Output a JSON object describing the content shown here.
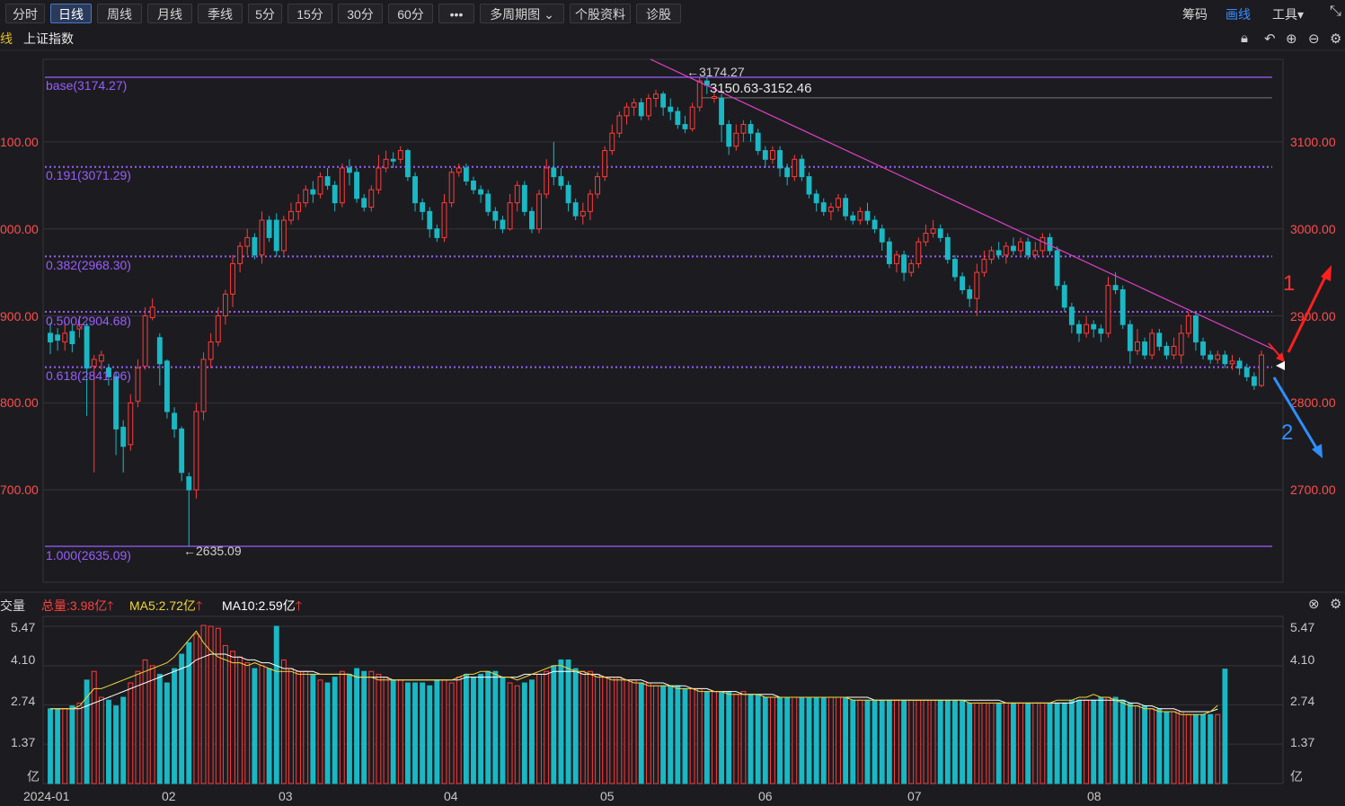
{
  "toolbar": {
    "tabs": [
      "分时",
      "日线",
      "周线",
      "月线",
      "季线",
      "5分",
      "15分",
      "30分",
      "60分",
      "•••",
      "多周期图 ⌄",
      "个股资料",
      "诊股"
    ],
    "active_tab": "日线",
    "right": [
      "筹码",
      "画线",
      "工具▾"
    ]
  },
  "subheader": {
    "prefix": "线",
    "index_name": "上证指数"
  },
  "price_axis": {
    "left": [
      "100.00",
      "000.00",
      "900.00",
      "800.00",
      "700.00"
    ],
    "right": [
      "3100.00",
      "3000.00",
      "2900.00",
      "2800.00",
      "2700.00"
    ]
  },
  "fib_labels": [
    "base(3174.27)",
    "0.191(3071.29)",
    "0.382(2968.30)",
    "0.500(2904.68)",
    "0.618(2841.06)",
    "1.000(2635.09)"
  ],
  "annotations": {
    "high": "←3174.27",
    "high_range": "3150.63-3152.46",
    "low": "←2635.09",
    "arrow1": "1",
    "arrow2": "2"
  },
  "volume_header": {
    "title": "交量",
    "total": "总量:3.98亿",
    "ma5": "MA5:2.72亿",
    "ma10": "MA10:2.59亿"
  },
  "volume_axis": {
    "left": [
      "5.47",
      "4.10",
      "2.74",
      "1.37",
      "亿"
    ],
    "right": [
      "5.47",
      "4.10",
      "2.74",
      "1.37",
      "亿"
    ]
  },
  "x_labels": [
    "2024-01",
    "02",
    "03",
    "04",
    "05",
    "06",
    "07",
    "08"
  ],
  "colors": {
    "up": "#ff3b3b",
    "down": "#1ab8c4",
    "fib": "#9b5cff",
    "trend": "#e040c8",
    "ma5": "#f2d43a",
    "ma10": "#ffffff"
  },
  "chart_data": {
    "type": "candlestick",
    "y_range": [
      2630,
      3180
    ],
    "ohlc": [
      [
        2880,
        2870,
        2892,
        2856
      ],
      [
        2878,
        2872,
        2886,
        2860
      ],
      [
        2870,
        2880,
        2893,
        2860
      ],
      [
        2882,
        2868,
        2890,
        2858
      ],
      [
        2885,
        2890,
        2900,
        2875
      ],
      [
        2888,
        2840,
        2892,
        2785
      ],
      [
        2842,
        2850,
        2855,
        2720
      ],
      [
        2848,
        2855,
        2860,
        2838
      ],
      [
        2840,
        2830,
        2845,
        2820
      ],
      [
        2830,
        2770,
        2836,
        2740
      ],
      [
        2772,
        2750,
        2780,
        2720
      ],
      [
        2752,
        2800,
        2810,
        2745
      ],
      [
        2802,
        2840,
        2850,
        2795
      ],
      [
        2842,
        2900,
        2910,
        2838
      ],
      [
        2898,
        2910,
        2920,
        2895
      ],
      [
        2875,
        2845,
        2880,
        2820
      ],
      [
        2848,
        2790,
        2850,
        2782
      ],
      [
        2788,
        2770,
        2795,
        2760
      ],
      [
        2770,
        2720,
        2773,
        2710
      ],
      [
        2715,
        2700,
        2720,
        2635
      ],
      [
        2700,
        2790,
        2800,
        2690
      ],
      [
        2790,
        2850,
        2858,
        2780
      ],
      [
        2850,
        2870,
        2880,
        2840
      ],
      [
        2870,
        2900,
        2910,
        2865
      ],
      [
        2900,
        2925,
        2930,
        2890
      ],
      [
        2925,
        2960,
        2970,
        2910
      ],
      [
        2960,
        2980,
        2985,
        2950
      ],
      [
        2980,
        2990,
        3000,
        2970
      ],
      [
        2990,
        2970,
        2995,
        2965
      ],
      [
        2970,
        3010,
        3020,
        2960
      ],
      [
        3010,
        2990,
        3015,
        2985
      ],
      [
        3010,
        2975,
        3018,
        2968
      ],
      [
        2975,
        3010,
        3015,
        2970
      ],
      [
        3010,
        3020,
        3030,
        3005
      ],
      [
        3020,
        3030,
        3040,
        3010
      ],
      [
        3030,
        3045,
        3050,
        3025
      ],
      [
        3045,
        3040,
        3055,
        3030
      ],
      [
        3040,
        3060,
        3065,
        3035
      ],
      [
        3060,
        3050,
        3070,
        3045
      ],
      [
        3050,
        3030,
        3055,
        3020
      ],
      [
        3030,
        3070,
        3075,
        3025
      ],
      [
        3070,
        3065,
        3080,
        3050
      ],
      [
        3065,
        3035,
        3070,
        3030
      ],
      [
        3035,
        3025,
        3040,
        3020
      ],
      [
        3025,
        3045,
        3050,
        3020
      ],
      [
        3045,
        3070,
        3085,
        3040
      ],
      [
        3070,
        3080,
        3090,
        3065
      ],
      [
        3080,
        3078,
        3088,
        3070
      ],
      [
        3080,
        3090,
        3095,
        3075
      ],
      [
        3090,
        3060,
        3092,
        3055
      ],
      [
        3060,
        3030,
        3065,
        3020
      ],
      [
        3030,
        3020,
        3035,
        3010
      ],
      [
        3020,
        3000,
        3025,
        2990
      ],
      [
        3000,
        2990,
        3005,
        2985
      ],
      [
        2990,
        3030,
        3040,
        2985
      ],
      [
        3030,
        3065,
        3070,
        3025
      ],
      [
        3065,
        3070,
        3075,
        3060
      ],
      [
        3070,
        3055,
        3075,
        3050
      ],
      [
        3055,
        3045,
        3060,
        3040
      ],
      [
        3045,
        3040,
        3050,
        3030
      ],
      [
        3040,
        3020,
        3045,
        3015
      ],
      [
        3020,
        3010,
        3025,
        3000
      ],
      [
        3010,
        3000,
        3015,
        2995
      ],
      [
        3000,
        3030,
        3040,
        2998
      ],
      [
        3030,
        3050,
        3055,
        3020
      ],
      [
        3050,
        3020,
        3055,
        3015
      ],
      [
        3020,
        3000,
        3025,
        2995
      ],
      [
        3000,
        3040,
        3045,
        2995
      ],
      [
        3040,
        3070,
        3080,
        3035
      ],
      [
        3070,
        3060,
        3100,
        3050
      ],
      [
        3060,
        3050,
        3070,
        3045
      ],
      [
        3050,
        3030,
        3055,
        3020
      ],
      [
        3030,
        3015,
        3035,
        3010
      ],
      [
        3015,
        3020,
        3030,
        3005
      ],
      [
        3020,
        3040,
        3045,
        3010
      ],
      [
        3040,
        3060,
        3065,
        3035
      ],
      [
        3060,
        3090,
        3095,
        3055
      ],
      [
        3090,
        3110,
        3120,
        3085
      ],
      [
        3110,
        3130,
        3135,
        3105
      ],
      [
        3130,
        3140,
        3145,
        3120
      ],
      [
        3140,
        3145,
        3150,
        3130
      ],
      [
        3145,
        3130,
        3150,
        3125
      ],
      [
        3130,
        3150,
        3155,
        3125
      ],
      [
        3150,
        3155,
        3160,
        3140
      ],
      [
        3155,
        3140,
        3158,
        3130
      ],
      [
        3140,
        3135,
        3150,
        3125
      ],
      [
        3135,
        3120,
        3140,
        3115
      ],
      [
        3120,
        3115,
        3130,
        3110
      ],
      [
        3115,
        3140,
        3145,
        3112
      ],
      [
        3140,
        3170,
        3174,
        3135
      ],
      [
        3170,
        3165,
        3174,
        3155
      ],
      [
        3150,
        3152,
        3158,
        3145
      ],
      [
        3150,
        3120,
        3155,
        3100
      ],
      [
        3120,
        3095,
        3125,
        3085
      ],
      [
        3095,
        3110,
        3120,
        3090
      ],
      [
        3110,
        3120,
        3125,
        3100
      ],
      [
        3120,
        3110,
        3125,
        3100
      ],
      [
        3110,
        3090,
        3115,
        3085
      ],
      [
        3090,
        3080,
        3095,
        3070
      ],
      [
        3080,
        3090,
        3095,
        3075
      ],
      [
        3090,
        3070,
        3095,
        3060
      ],
      [
        3070,
        3060,
        3075,
        3050
      ],
      [
        3060,
        3080,
        3085,
        3055
      ],
      [
        3080,
        3060,
        3085,
        3055
      ],
      [
        3060,
        3040,
        3065,
        3035
      ],
      [
        3040,
        3030,
        3045,
        3020
      ],
      [
        3030,
        3020,
        3035,
        3015
      ],
      [
        3020,
        3025,
        3030,
        3010
      ],
      [
        3025,
        3035,
        3040,
        3020
      ],
      [
        3035,
        3015,
        3040,
        3010
      ],
      [
        3015,
        3010,
        3020,
        3005
      ],
      [
        3010,
        3020,
        3025,
        3005
      ],
      [
        3020,
        3010,
        3030,
        3005
      ],
      [
        3010,
        3000,
        3015,
        2995
      ],
      [
        3000,
        2985,
        3005,
        2975
      ],
      [
        2985,
        2960,
        2990,
        2955
      ],
      [
        2960,
        2970,
        2975,
        2950
      ],
      [
        2970,
        2950,
        2975,
        2940
      ],
      [
        2950,
        2960,
        2965,
        2945
      ],
      [
        2960,
        2985,
        2990,
        2955
      ],
      [
        2985,
        2995,
        3005,
        2980
      ],
      [
        2995,
        3000,
        3010,
        2990
      ],
      [
        3000,
        2990,
        3005,
        2985
      ],
      [
        2990,
        2965,
        2995,
        2960
      ],
      [
        2965,
        2945,
        2970,
        2940
      ],
      [
        2945,
        2930,
        2950,
        2925
      ],
      [
        2930,
        2920,
        2935,
        2910
      ],
      [
        2920,
        2950,
        2960,
        2900
      ],
      [
        2950,
        2965,
        2975,
        2945
      ],
      [
        2965,
        2975,
        2980,
        2960
      ],
      [
        2975,
        2970,
        2985,
        2965
      ],
      [
        2970,
        2980,
        2985,
        2960
      ],
      [
        2980,
        2975,
        2990,
        2970
      ],
      [
        2975,
        2985,
        2990,
        2970
      ],
      [
        2985,
        2970,
        2990,
        2965
      ],
      [
        2970,
        2975,
        2985,
        2965
      ],
      [
        2975,
        2990,
        2995,
        2970
      ],
      [
        2990,
        2975,
        2995,
        2970
      ],
      [
        2975,
        2935,
        2980,
        2930
      ],
      [
        2935,
        2910,
        2940,
        2905
      ],
      [
        2910,
        2890,
        2915,
        2880
      ],
      [
        2890,
        2880,
        2895,
        2870
      ],
      [
        2880,
        2890,
        2900,
        2875
      ],
      [
        2890,
        2885,
        2895,
        2875
      ],
      [
        2885,
        2880,
        2890,
        2870
      ],
      [
        2880,
        2935,
        2945,
        2875
      ],
      [
        2935,
        2930,
        2950,
        2925
      ],
      [
        2930,
        2890,
        2935,
        2885
      ],
      [
        2890,
        2860,
        2895,
        2845
      ],
      [
        2860,
        2870,
        2885,
        2855
      ],
      [
        2870,
        2855,
        2875,
        2850
      ],
      [
        2855,
        2880,
        2885,
        2850
      ],
      [
        2880,
        2865,
        2885,
        2860
      ],
      [
        2865,
        2855,
        2870,
        2850
      ],
      [
        2855,
        2865,
        2875,
        2850
      ],
      [
        2855,
        2880,
        2890,
        2845
      ],
      [
        2880,
        2900,
        2905,
        2875
      ],
      [
        2900,
        2870,
        2905,
        2860
      ],
      [
        2870,
        2855,
        2875,
        2850
      ],
      [
        2855,
        2850,
        2860,
        2845
      ],
      [
        2850,
        2855,
        2860,
        2845
      ],
      [
        2855,
        2845,
        2860,
        2840
      ],
      [
        2845,
        2848,
        2855,
        2838
      ],
      [
        2848,
        2840,
        2852,
        2832
      ],
      [
        2840,
        2830,
        2845,
        2825
      ],
      [
        2830,
        2820,
        2835,
        2815
      ],
      [
        2820,
        2855,
        2860,
        2818
      ]
    ],
    "volume_range": [
      0,
      5.47
    ],
    "volume": [
      2.6,
      2.6,
      2.6,
      2.7,
      2.8,
      3.6,
      3.9,
      3.0,
      2.9,
      2.7,
      3.0,
      3.5,
      3.9,
      4.3,
      4.1,
      3.8,
      3.5,
      4.0,
      4.5,
      4.9,
      5.2,
      5.5,
      5.47,
      5.4,
      4.8,
      4.6,
      4.4,
      4.2,
      4.0,
      4.1,
      4.0,
      5.47,
      4.3,
      4.0,
      3.9,
      3.9,
      3.8,
      3.6,
      3.5,
      3.7,
      3.9,
      3.8,
      4.0,
      3.9,
      3.9,
      3.8,
      3.7,
      3.6,
      3.6,
      3.5,
      3.5,
      3.5,
      3.4,
      3.6,
      3.6,
      3.5,
      3.7,
      3.8,
      3.7,
      3.8,
      3.9,
      3.9,
      3.7,
      3.5,
      3.4,
      3.5,
      3.6,
      3.8,
      3.9,
      4.1,
      4.3,
      4.3,
      4.0,
      3.9,
      3.9,
      3.8,
      3.7,
      3.7,
      3.7,
      3.6,
      3.6,
      3.5,
      3.5,
      3.4,
      3.4,
      3.4,
      3.4,
      3.3,
      3.3,
      3.3,
      3.2,
      3.2,
      3.2,
      3.2,
      3.1,
      3.2,
      3.1,
      3.1,
      3.0,
      3.0,
      3.0,
      3.0,
      3.0,
      3.0,
      3.0,
      3.0,
      3.0,
      3.0,
      3.0,
      3.0,
      2.9,
      2.9,
      2.9,
      2.9,
      2.9,
      2.9,
      2.9,
      2.9,
      2.9,
      2.9,
      2.9,
      2.9,
      2.9,
      2.9,
      2.9,
      2.9,
      2.8,
      2.8,
      2.8,
      2.8,
      2.8,
      2.8,
      2.8,
      2.8,
      2.8,
      2.8,
      2.8,
      2.8,
      2.8,
      2.8,
      2.9,
      2.9,
      2.9,
      2.9,
      3.0,
      3.0,
      3.0,
      2.9,
      2.8,
      2.7,
      2.7,
      2.6,
      2.6,
      2.5,
      2.5,
      2.5,
      2.4,
      2.4,
      2.4,
      2.4,
      2.4,
      3.98
    ],
    "ma5": [
      2.6,
      2.6,
      2.6,
      2.6,
      2.7,
      3.0,
      3.3,
      3.3,
      3.4,
      3.5,
      3.6,
      3.7,
      3.8,
      3.9,
      4.0,
      4.1,
      4.2,
      4.4,
      4.7,
      5.0,
      5.3,
      4.9,
      4.6,
      4.4,
      4.3,
      4.2,
      4.2,
      4.1,
      4.2,
      4.1,
      4.0,
      3.9,
      3.9,
      3.9,
      3.8,
      3.8,
      3.8,
      3.8,
      3.8,
      3.8,
      3.8,
      3.8,
      3.7,
      3.7,
      3.7,
      3.6,
      3.6,
      3.6,
      3.6,
      3.6,
      3.6,
      3.6,
      3.6,
      3.6,
      3.6,
      3.6,
      3.7,
      3.8,
      3.8,
      3.9,
      3.9,
      3.8,
      3.7,
      3.7,
      3.6,
      3.7,
      3.8,
      3.9,
      4.0,
      4.1,
      4.1,
      4.0,
      3.9,
      3.9,
      3.8,
      3.7,
      3.7,
      3.6,
      3.6,
      3.6,
      3.5,
      3.5,
      3.4,
      3.4,
      3.4,
      3.4,
      3.3,
      3.3,
      3.3,
      3.2,
      3.2,
      3.2,
      3.2,
      3.1,
      3.1,
      3.1,
      3.1,
      3.1,
      3.0,
      3.0,
      3.0,
      3.0,
      3.0,
      3.0,
      3.0,
      3.0,
      3.0,
      3.0,
      3.0,
      3.0,
      2.9,
      2.9,
      2.9,
      2.9,
      2.9,
      2.9,
      2.9,
      2.9,
      2.9,
      2.9,
      2.9,
      2.9,
      2.9,
      2.9,
      2.9,
      2.9,
      2.8,
      2.8,
      2.8,
      2.8,
      2.8,
      2.8,
      2.8,
      2.8,
      2.8,
      2.8,
      2.8,
      2.8,
      2.9,
      2.9,
      2.9,
      3.0,
      3.0,
      3.1,
      3.0,
      3.0,
      2.9,
      2.8,
      2.7,
      2.7,
      2.6,
      2.6,
      2.5,
      2.5,
      2.5,
      2.4,
      2.4,
      2.4,
      2.4,
      2.5,
      2.72
    ],
    "ma10": [
      2.6,
      2.6,
      2.6,
      2.6,
      2.6,
      2.7,
      2.8,
      2.9,
      3.0,
      3.1,
      3.2,
      3.3,
      3.4,
      3.5,
      3.6,
      3.7,
      3.8,
      3.9,
      4.0,
      4.1,
      4.3,
      4.4,
      4.5,
      4.5,
      4.5,
      4.4,
      4.4,
      4.3,
      4.3,
      4.2,
      4.2,
      4.1,
      4.0,
      4.0,
      3.9,
      3.9,
      3.9,
      3.8,
      3.8,
      3.8,
      3.8,
      3.8,
      3.7,
      3.7,
      3.7,
      3.7,
      3.7,
      3.6,
      3.6,
      3.6,
      3.6,
      3.6,
      3.6,
      3.6,
      3.6,
      3.6,
      3.6,
      3.7,
      3.7,
      3.7,
      3.7,
      3.7,
      3.7,
      3.7,
      3.7,
      3.8,
      3.8,
      3.8,
      3.8,
      3.9,
      3.9,
      3.9,
      3.9,
      3.8,
      3.8,
      3.8,
      3.7,
      3.7,
      3.7,
      3.6,
      3.6,
      3.6,
      3.5,
      3.5,
      3.5,
      3.4,
      3.4,
      3.4,
      3.3,
      3.3,
      3.3,
      3.2,
      3.2,
      3.2,
      3.2,
      3.1,
      3.1,
      3.1,
      3.1,
      3.1,
      3.0,
      3.0,
      3.0,
      3.0,
      3.0,
      3.0,
      3.0,
      3.0,
      3.0,
      3.0,
      3.0,
      3.0,
      3.0,
      2.9,
      2.9,
      2.9,
      2.9,
      2.9,
      2.9,
      2.9,
      2.9,
      2.9,
      2.9,
      2.9,
      2.9,
      2.9,
      2.9,
      2.9,
      2.9,
      2.9,
      2.9,
      2.8,
      2.8,
      2.8,
      2.8,
      2.8,
      2.8,
      2.8,
      2.8,
      2.8,
      2.8,
      2.9,
      2.9,
      2.9,
      2.9,
      2.9,
      2.9,
      2.9,
      2.8,
      2.8,
      2.7,
      2.7,
      2.6,
      2.6,
      2.6,
      2.5,
      2.5,
      2.5,
      2.5,
      2.5,
      2.59
    ]
  }
}
